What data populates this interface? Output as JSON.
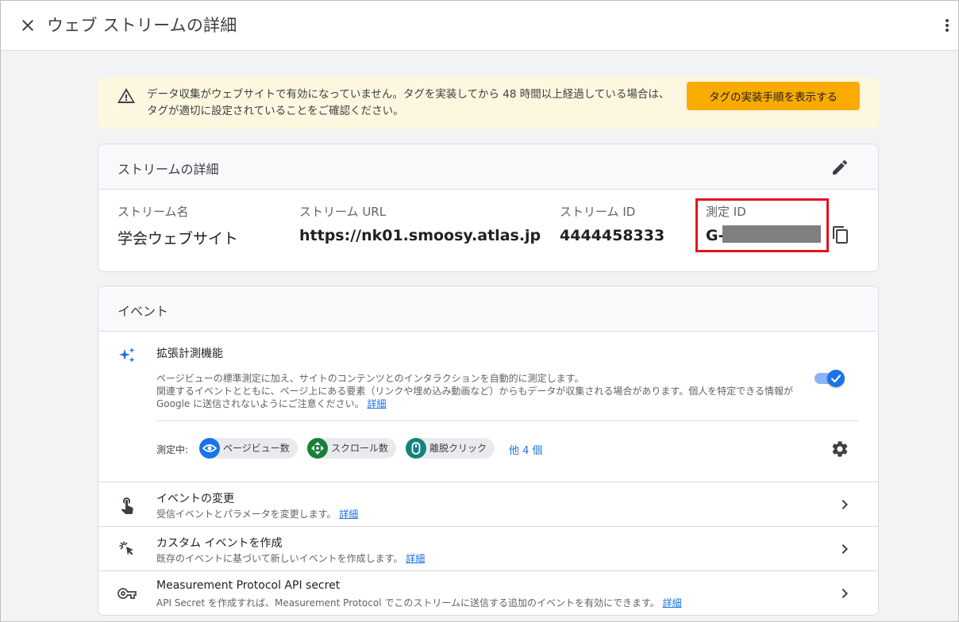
{
  "header": {
    "title": "ウェブ ストリームの詳細"
  },
  "warning": {
    "text": "データ収集がウェブサイトで有効になっていません。タグを実装してから 48 時間以上経過している場合は、タグが適切に設定されていることをご確認ください。",
    "button_label": "タグの実装手順を表示する",
    "background_color": "#fef7e0",
    "button_color": "#f9ab00"
  },
  "stream_details": {
    "title": "ストリームの詳細",
    "fields": {
      "name": {
        "label": "ストリーム名",
        "value": "学会ウェブサイト"
      },
      "url": {
        "label": "ストリーム URL",
        "value": "https://nk01.smoosy.atlas.jp"
      },
      "id": {
        "label": "ストリーム ID",
        "value": "4444458333"
      },
      "measurement_id": {
        "label": "測定 ID",
        "value": "G-"
      }
    },
    "highlight_color": "#e5121f"
  },
  "events": {
    "title": "イベント",
    "enhanced_measurement": {
      "title": "拡張計測機能",
      "desc_line1": "ページビューの標準測定に加え、サイトのコンテンツとのインタラクションを自動的に測定します。",
      "desc_line2": "関連するイベントとともに、ページ上にある要素（リンクや埋め込み動画など）からもデータが収集される場合があります。個人を特定できる情報が",
      "desc_line3": "Google に送信されないようにご注意ください。",
      "detail_link": "詳細",
      "enabled": true,
      "measuring_label": "測定中:",
      "chips": [
        {
          "label": "ページビュー数",
          "icon": "eye-icon",
          "color": "#1a73e8"
        },
        {
          "label": "スクロール数",
          "icon": "scroll-icon",
          "color": "#188038"
        },
        {
          "label": "離脱クリック",
          "icon": "mouse-icon",
          "color": "#12837e"
        }
      ],
      "more_label": "他 4 個"
    },
    "rows": [
      {
        "title": "イベントの変更",
        "desc": "受信イベントとパラメータを変更します。",
        "link": "詳細",
        "icon": "touch-icon"
      },
      {
        "title": "カスタム イベントを作成",
        "desc": "既存のイベントに基づいて新しいイベントを作成します。",
        "link": "詳細",
        "icon": "click-icon"
      },
      {
        "title": "Measurement Protocol API secret",
        "desc": "API Secret を作成すれば、Measurement Protocol でこのストリームに送信する追加のイベントを有効にできます。",
        "link": "詳細",
        "icon": "key-icon"
      }
    ]
  }
}
